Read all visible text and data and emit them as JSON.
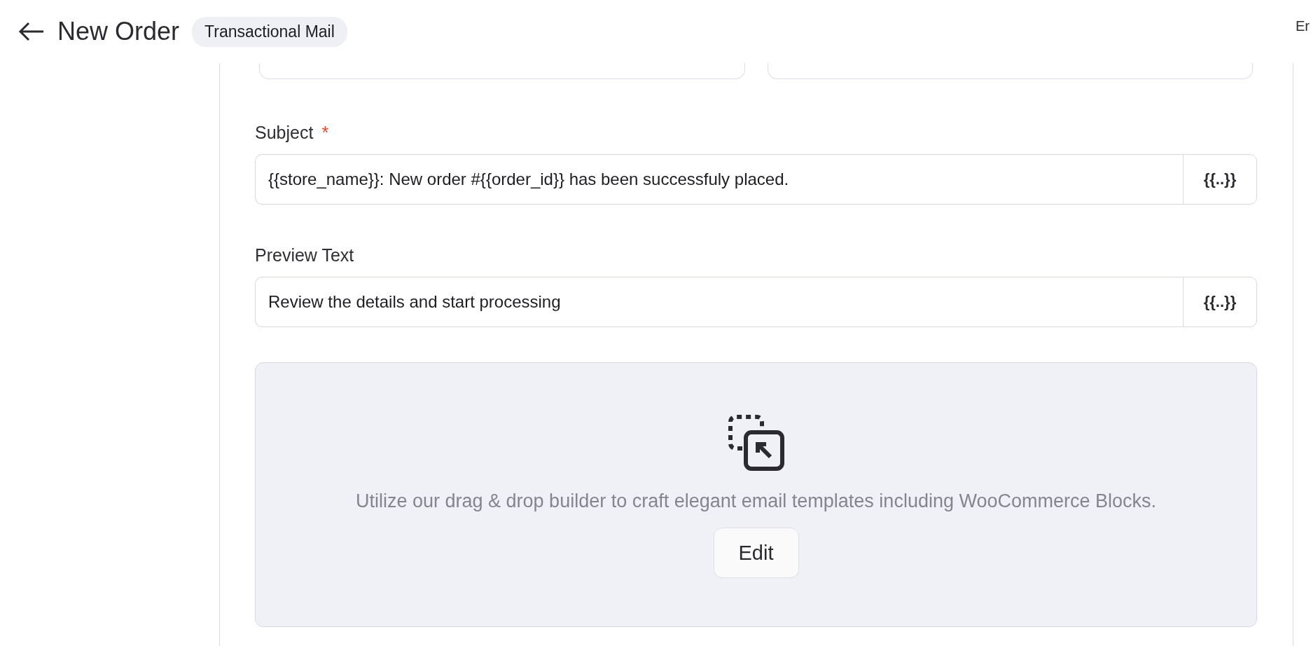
{
  "header": {
    "title": "New Order",
    "badge": "Transactional Mail",
    "cut_text": "Er"
  },
  "top_fields": [
    {
      "kind": "cut"
    },
    {
      "kind": "cut"
    }
  ],
  "fields": [
    {
      "label": "Subject",
      "required": true,
      "required_mark": "*",
      "value": "{{store_name}}: New order #{{order_id}} has been successfuly placed.",
      "tag_button": "{{..}}"
    },
    {
      "label": "Preview Text",
      "required": false,
      "value": "Review the details and start processing",
      "tag_button": "{{..}}"
    }
  ],
  "builder": {
    "description": "Utilize our drag & drop builder to craft elegant email templates including WooCommerce Blocks.",
    "button": "Edit"
  }
}
